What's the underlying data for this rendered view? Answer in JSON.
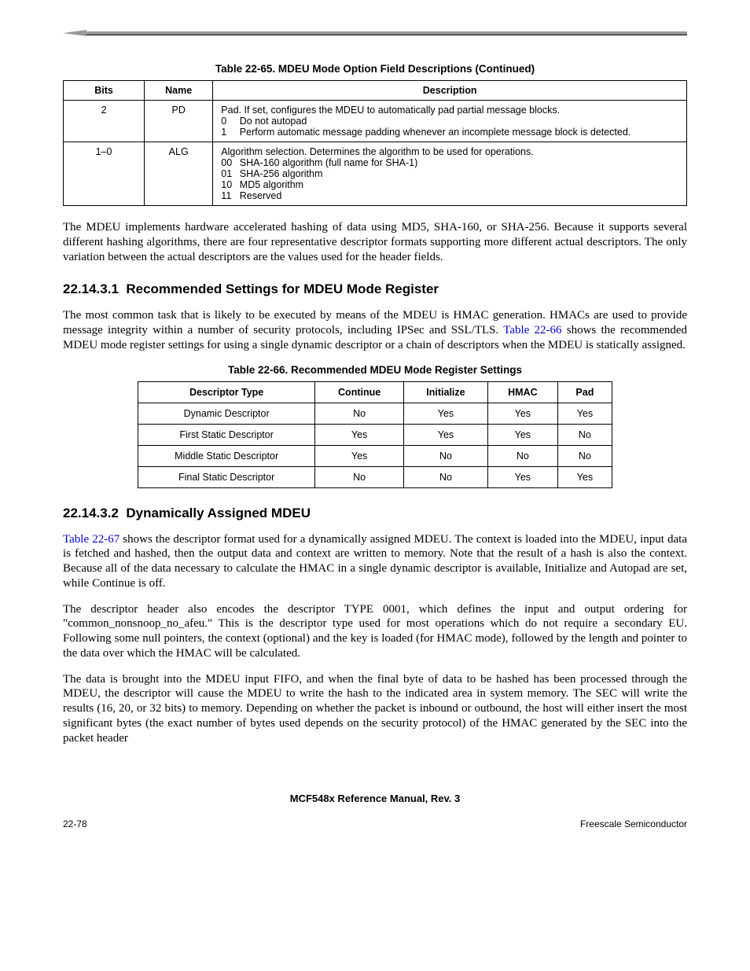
{
  "table1": {
    "caption": "Table 22-65. MDEU Mode Option Field Descriptions (Continued)",
    "headers": {
      "bits": "Bits",
      "name": "Name",
      "desc": "Description"
    },
    "rows": [
      {
        "bits": "2",
        "name": "PD",
        "intro": "Pad. If set, configures the MDEU to automatically pad partial message blocks.",
        "opts": [
          {
            "code": "0",
            "text": "Do not autopad"
          },
          {
            "code": "1",
            "text": "Perform automatic message padding whenever an incomplete message block is detected."
          }
        ]
      },
      {
        "bits": "1–0",
        "name": "ALG",
        "intro": "Algorithm selection. Determines the algorithm to be used for operations.",
        "opts": [
          {
            "code": "00",
            "text": "SHA-160 algorithm (full name for SHA-1)"
          },
          {
            "code": "01",
            "text": "SHA-256 algorithm"
          },
          {
            "code": "10",
            "text": "MD5 algorithm"
          },
          {
            "code": "11",
            "text": "Reserved"
          }
        ]
      }
    ]
  },
  "para1": "The MDEU implements hardware accelerated hashing of data using MD5, SHA-160, or SHA-256. Because it supports several different hashing algorithms, there are four representative descriptor formats supporting more different actual descriptors. The only variation between the actual descriptors are the values used for the header fields.",
  "section1": {
    "num": "22.14.3.1",
    "title": "Recommended Settings for MDEU Mode Register"
  },
  "para2a": "The most common task that is likely to be executed by means of the MDEU is HMAC generation. HMACs are used to provide message integrity within a number of security protocols, including IPSec and SSL/TLS. ",
  "para2link": "Table 22-66",
  "para2b": " shows the recommended MDEU mode register settings for using a single dynamic descriptor or a chain of descriptors when the MDEU is statically assigned.",
  "table2": {
    "caption": "Table 22-66. Recommended MDEU Mode Register Settings",
    "headers": {
      "type": "Descriptor Type",
      "cont": "Continue",
      "init": "Initialize",
      "hmac": "HMAC",
      "pad": "Pad"
    },
    "rows": [
      {
        "type": "Dynamic Descriptor",
        "cont": "No",
        "init": "Yes",
        "hmac": "Yes",
        "pad": "Yes"
      },
      {
        "type": "First Static Descriptor",
        "cont": "Yes",
        "init": "Yes",
        "hmac": "Yes",
        "pad": "No"
      },
      {
        "type": "Middle Static Descriptor",
        "cont": "Yes",
        "init": "No",
        "hmac": "No",
        "pad": "No"
      },
      {
        "type": "Final Static Descriptor",
        "cont": "No",
        "init": "No",
        "hmac": "Yes",
        "pad": "Yes"
      }
    ]
  },
  "section2": {
    "num": "22.14.3.2",
    "title": "Dynamically Assigned MDEU"
  },
  "para3link": "Table 22-67",
  "para3": " shows the descriptor format used for a dynamically assigned MDEU. The context is loaded into the MDEU, input data is fetched and hashed, then the output data and context are written to memory. Note that the result of a hash is also the context. Because all of the data necessary to calculate the HMAC in a single dynamic descriptor is available, Initialize and Autopad are set, while Continue is off.",
  "para4": "The descriptor header also encodes the descriptor TYPE 0001, which defines the input and output ordering for \"common_nonsnoop_no_afeu.\" This is the descriptor type used for most operations which do not require a secondary EU. Following some null pointers, the context (optional) and the key is loaded (for HMAC mode), followed by the length and pointer to the data over which the HMAC will be calculated.",
  "para5": "The data is brought into the MDEU input FIFO, and when the final byte of data to be hashed has been processed through the MDEU, the descriptor will cause the MDEU to write the hash to the indicated area in system memory. The SEC will write the results (16, 20, or 32 bits) to memory. Depending on whether the packet is inbound or outbound, the host will either insert the most significant bytes (the exact number of bytes used depends on the security protocol) of the HMAC generated by the SEC into the packet header",
  "footer": {
    "title": "MCF548x Reference Manual, Rev. 3",
    "left": "22-78",
    "right": "Freescale Semiconductor"
  }
}
